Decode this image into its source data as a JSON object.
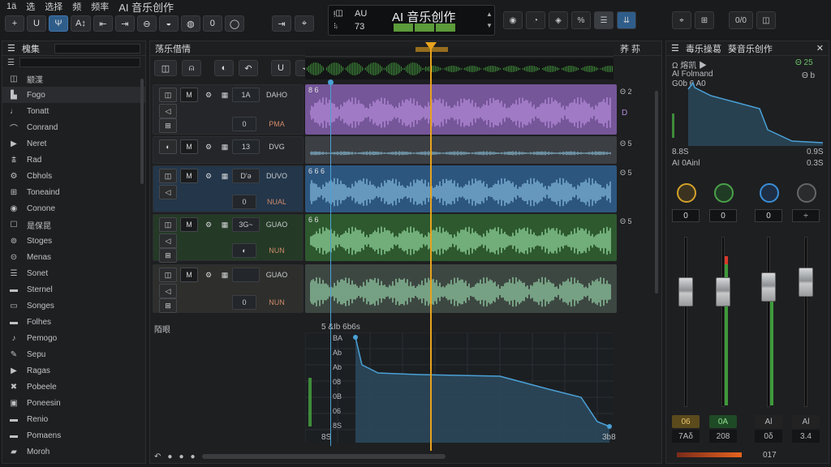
{
  "menu": [
    "1ä",
    "选",
    "选择",
    "频",
    "频率",
    "AI 音乐创作"
  ],
  "toolbar": {
    "buttons": [
      "+",
      "U",
      "Ψ",
      "A↕",
      "⇤",
      "⇥",
      "⊖",
      "◒",
      "◍",
      "0",
      "◯"
    ]
  },
  "transport": [
    "⇥",
    "⌖"
  ],
  "lcd": {
    "left_top": "ᴉ◫",
    "left_bot": "⁝ᵢ",
    "mid_top": "AU",
    "mid_bot": "73",
    "title": "AI 音乐创作",
    "seg": [
      "",
      "",
      ""
    ]
  },
  "right_tools": [
    "◉",
    "◔",
    "◈",
    "%",
    "☰",
    "⇊",
    "⌖",
    "⊞",
    "0/0",
    "◫"
  ],
  "browser": {
    "title": "槐集",
    "items": [
      {
        "icon": "◫",
        "label": "颛渫"
      },
      {
        "icon": "▙",
        "label": "Fogo"
      },
      {
        "icon": "♩",
        "label": "Tonatt"
      },
      {
        "icon": "⌒",
        "label": "Conrand"
      },
      {
        "icon": "▶",
        "label": "Neret"
      },
      {
        "icon": "⩲",
        "label": "Rad"
      },
      {
        "icon": "⚙",
        "label": "Cbhols"
      },
      {
        "icon": "⊞",
        "label": "Toneaind"
      },
      {
        "icon": "◉",
        "label": "Conone"
      },
      {
        "icon": "☐",
        "label": "是保昆"
      },
      {
        "icon": "⊚",
        "label": "Stoges"
      },
      {
        "icon": "⊝",
        "label": "Menas"
      },
      {
        "icon": "☰",
        "label": "Sonet"
      },
      {
        "icon": "▬",
        "label": "Sternel"
      },
      {
        "icon": "▭",
        "label": "Songes"
      },
      {
        "icon": "▬",
        "label": "Folhes"
      },
      {
        "icon": "♪",
        "label": "Pemogo"
      },
      {
        "icon": "✎",
        "label": "Sepu"
      },
      {
        "icon": "▶",
        "label": "Ragas"
      },
      {
        "icon": "✖",
        "label": "Pobeele"
      },
      {
        "icon": "▣",
        "label": "Poneesin"
      },
      {
        "icon": "▬",
        "label": "Renio"
      },
      {
        "icon": "▬",
        "label": "Pomaens"
      },
      {
        "icon": "▰",
        "label": "Moroh"
      }
    ]
  },
  "arrange": {
    "title": "荡乐借情",
    "right_label": "荞 荪",
    "ruler_btns": [
      "◫",
      "⍝",
      "◐",
      "↶",
      "U",
      "⌁"
    ]
  },
  "tracks": [
    {
      "icon1": "◫",
      "icon2": "◁",
      "icon3": "⊞",
      "label1": "1A",
      "label2": "DAHO",
      "knob": "0",
      "mode": "PMA",
      "clip_name": "8 6",
      "side": "Θ 2",
      "tail": "D"
    },
    {
      "icon1": "◐",
      "label1": "13",
      "label2": "DVG",
      "side": "Θ 5"
    },
    {
      "icon1": "◫",
      "icon2": "◁",
      "label1": "D'ə",
      "label2": "DUVO",
      "knob": "0",
      "mode": "NUAL",
      "clip_name": "6 6 6",
      "side": "Θ 5"
    },
    {
      "icon1": "◫",
      "icon2": "◁",
      "icon3": "⊞",
      "label1": "3G~",
      "label2": "GUAO",
      "knob": "◐",
      "mode": "NUN",
      "clip_name": "6 6",
      "side": "Θ 5"
    },
    {
      "icon1": "◫",
      "icon2": "◁",
      "icon3": "⊞",
      "label1": "",
      "label2": "GUAO",
      "knob": "0",
      "mode": "NUN",
      "clip_name": "",
      "side": ""
    }
  ],
  "automation": {
    "label": "陌眼",
    "header": "5 &Ib 6b6s",
    "y_labels": [
      "BA",
      "Ab",
      "Ab",
      "08",
      "0B",
      "06",
      "8S"
    ],
    "start": "8S",
    "end": "3b8"
  },
  "inspector": {
    "title": "毒乐操葛",
    "subtitle": "葵音乐创作",
    "row1": "Ω 熔凯 ▶",
    "row2": "Al Folmand",
    "row3": "G0b 6 A0",
    "val1": "Θ 25",
    "val2": "Θ b",
    "foot_left": "8.8S",
    "foot_right": "0.9S",
    "foot2_left": "AI 0Ainl",
    "foot2_right": "0.3S",
    "knob_vals": [
      "0",
      "0",
      "0",
      "÷"
    ],
    "ch_top": [
      "06",
      "0A",
      "Al",
      "Al"
    ],
    "ch_bot": [
      "7Aδ",
      "208",
      "0δ",
      "3.4"
    ],
    "status": "017"
  },
  "colors": {
    "purple": "#7a5aa0",
    "blue": "#2e5a85",
    "green": "#2f5d30",
    "gray": "#3e4146",
    "playhead": "#e8a31e",
    "accent": "#3a8fd8"
  }
}
